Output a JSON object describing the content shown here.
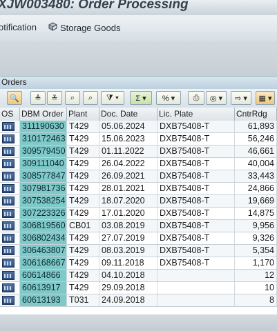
{
  "window": {
    "title": "XJW003480: Order Processing"
  },
  "appbar": {
    "items": [
      {
        "label": "otification",
        "icon": ""
      },
      {
        "label": "Storage Goods",
        "icon": "storage-goods-icon"
      }
    ]
  },
  "panel": {
    "tab_label": "Orders"
  },
  "toolbar": {
    "buttons": [
      {
        "name": "details-icon",
        "glyph": "🔍"
      },
      {
        "name": "sort-ascending-icon",
        "glyph": "⇑"
      },
      {
        "name": "sort-descending-icon",
        "glyph": "⇓"
      },
      {
        "name": "find-icon",
        "glyph": "🔭"
      },
      {
        "name": "filter-icon",
        "glyph": "▼"
      },
      {
        "name": "sum-icon",
        "glyph": "Σ"
      },
      {
        "name": "subtotal-icon",
        "glyph": "%"
      },
      {
        "name": "print-icon",
        "glyph": "⎙"
      },
      {
        "name": "views-icon",
        "glyph": "◎"
      },
      {
        "name": "export-icon",
        "glyph": "⇨"
      },
      {
        "name": "layout-icon",
        "glyph": "▦"
      }
    ]
  },
  "table": {
    "columns": [
      "OS",
      "DBM Order",
      "Plant",
      "Doc. Date",
      "Lic. Plate",
      "CntrRdg"
    ],
    "rows": [
      {
        "order": "311190630",
        "plant": "T429",
        "date": "05.06.2024",
        "plate": "DXB75408-T",
        "cntr": "61,893"
      },
      {
        "order": "310172463",
        "plant": "T429",
        "date": "15.06.2023",
        "plate": "DXB75408-T",
        "cntr": "56,246"
      },
      {
        "order": "309579450",
        "plant": "T429",
        "date": "01.11.2022",
        "plate": "DXB75408-T",
        "cntr": "46,661"
      },
      {
        "order": "309111040",
        "plant": "T429",
        "date": "26.04.2022",
        "plate": "DXB75408-T",
        "cntr": "40,004"
      },
      {
        "order": "308577847",
        "plant": "T429",
        "date": "26.09.2021",
        "plate": "DXB75408-T",
        "cntr": "33,443"
      },
      {
        "order": "307981736",
        "plant": "T429",
        "date": "28.01.2021",
        "plate": "DXB75408-T",
        "cntr": "24,866"
      },
      {
        "order": "307538254",
        "plant": "T429",
        "date": "18.07.2020",
        "plate": "DXB75408-T",
        "cntr": "19,669"
      },
      {
        "order": "307223326",
        "plant": "T429",
        "date": "17.01.2020",
        "plate": "DXB75408-T",
        "cntr": "14,875"
      },
      {
        "order": "306819560",
        "plant": "CB01",
        "date": "03.08.2019",
        "plate": "DXB75408-T",
        "cntr": "9,956"
      },
      {
        "order": "306802434",
        "plant": "T429",
        "date": "27.07.2019",
        "plate": "DXB75408-T",
        "cntr": "9,326"
      },
      {
        "order": "306463807",
        "plant": "T429",
        "date": "08.03.2019",
        "plate": "DXB75408-T",
        "cntr": "5,354"
      },
      {
        "order": "306168667",
        "plant": "T429",
        "date": "09.11.2018",
        "plate": "DXB75408-T",
        "cntr": "1,170"
      },
      {
        "order": "60614866",
        "plant": "T429",
        "date": "04.10.2018",
        "plate": "",
        "cntr": "12"
      },
      {
        "order": "60613917",
        "plant": "T429",
        "date": "29.09.2018",
        "plate": "",
        "cntr": "10"
      },
      {
        "order": "60613193",
        "plant": "T031",
        "date": "24.09.2018",
        "plate": "",
        "cntr": "8"
      }
    ]
  }
}
